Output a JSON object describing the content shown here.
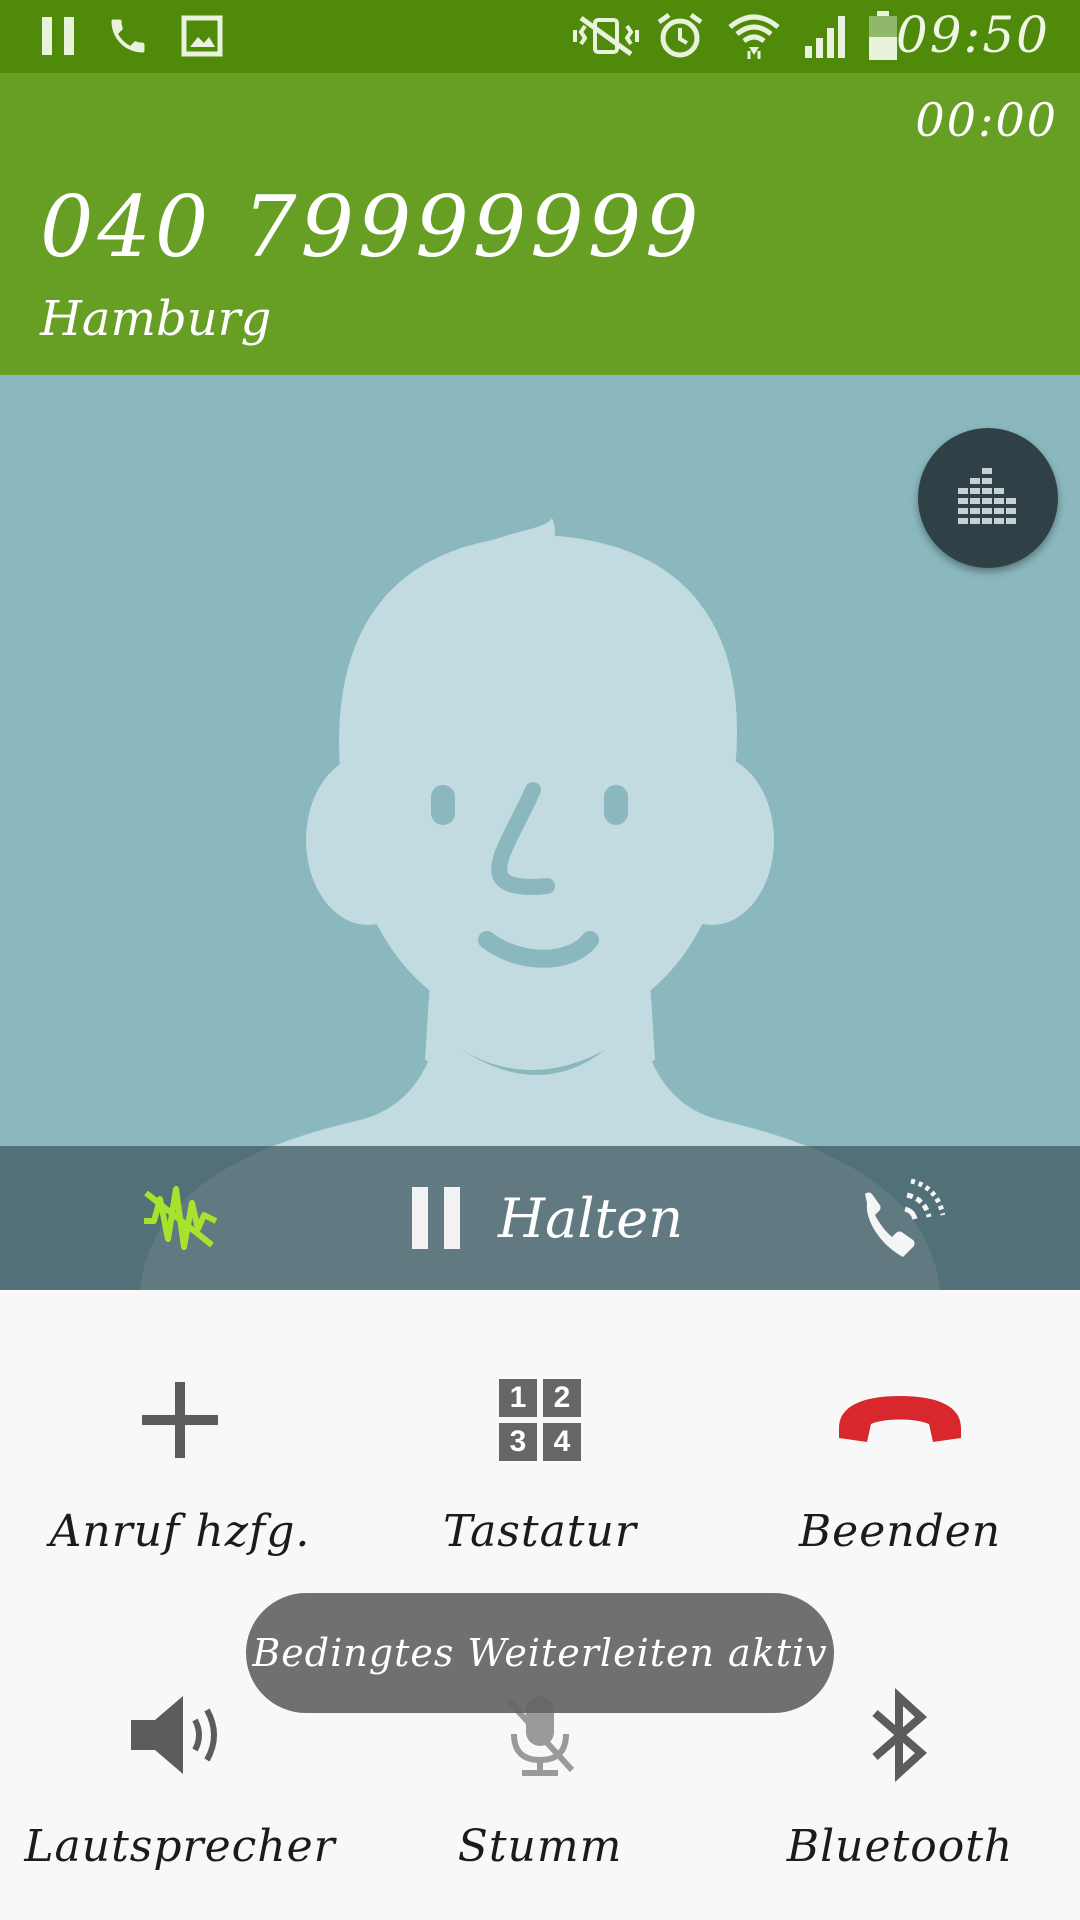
{
  "status_bar": {
    "time": "09:50",
    "left_icons": [
      "pause-icon",
      "phone-icon",
      "gallery-icon"
    ],
    "right_icons": [
      "vibrate-mute-icon",
      "alarm-icon",
      "wifi-icon",
      "signal-icon",
      "battery-icon"
    ]
  },
  "call": {
    "timer": "00:00",
    "number": "040 79999999",
    "location": "Hamburg"
  },
  "hold_bar": {
    "hold_label": "Halten"
  },
  "controls": {
    "add_call": "Anruf hzfg.",
    "keypad": "Tastatur",
    "end_call": "Beenden",
    "speaker": "Lautsprecher",
    "mute": "Stumm",
    "bluetooth": "Bluetooth",
    "keypad_digits": [
      "1",
      "2",
      "3",
      "4"
    ]
  },
  "toast": {
    "message": "Bedingtes Weiterleiten aktiv"
  },
  "colors": {
    "status_bar": "#4f8a0b",
    "header": "#679f24",
    "avatar_bg": "#8ab8be",
    "end_call_red": "#d8282e",
    "noise_icon": "#a6e22e"
  }
}
